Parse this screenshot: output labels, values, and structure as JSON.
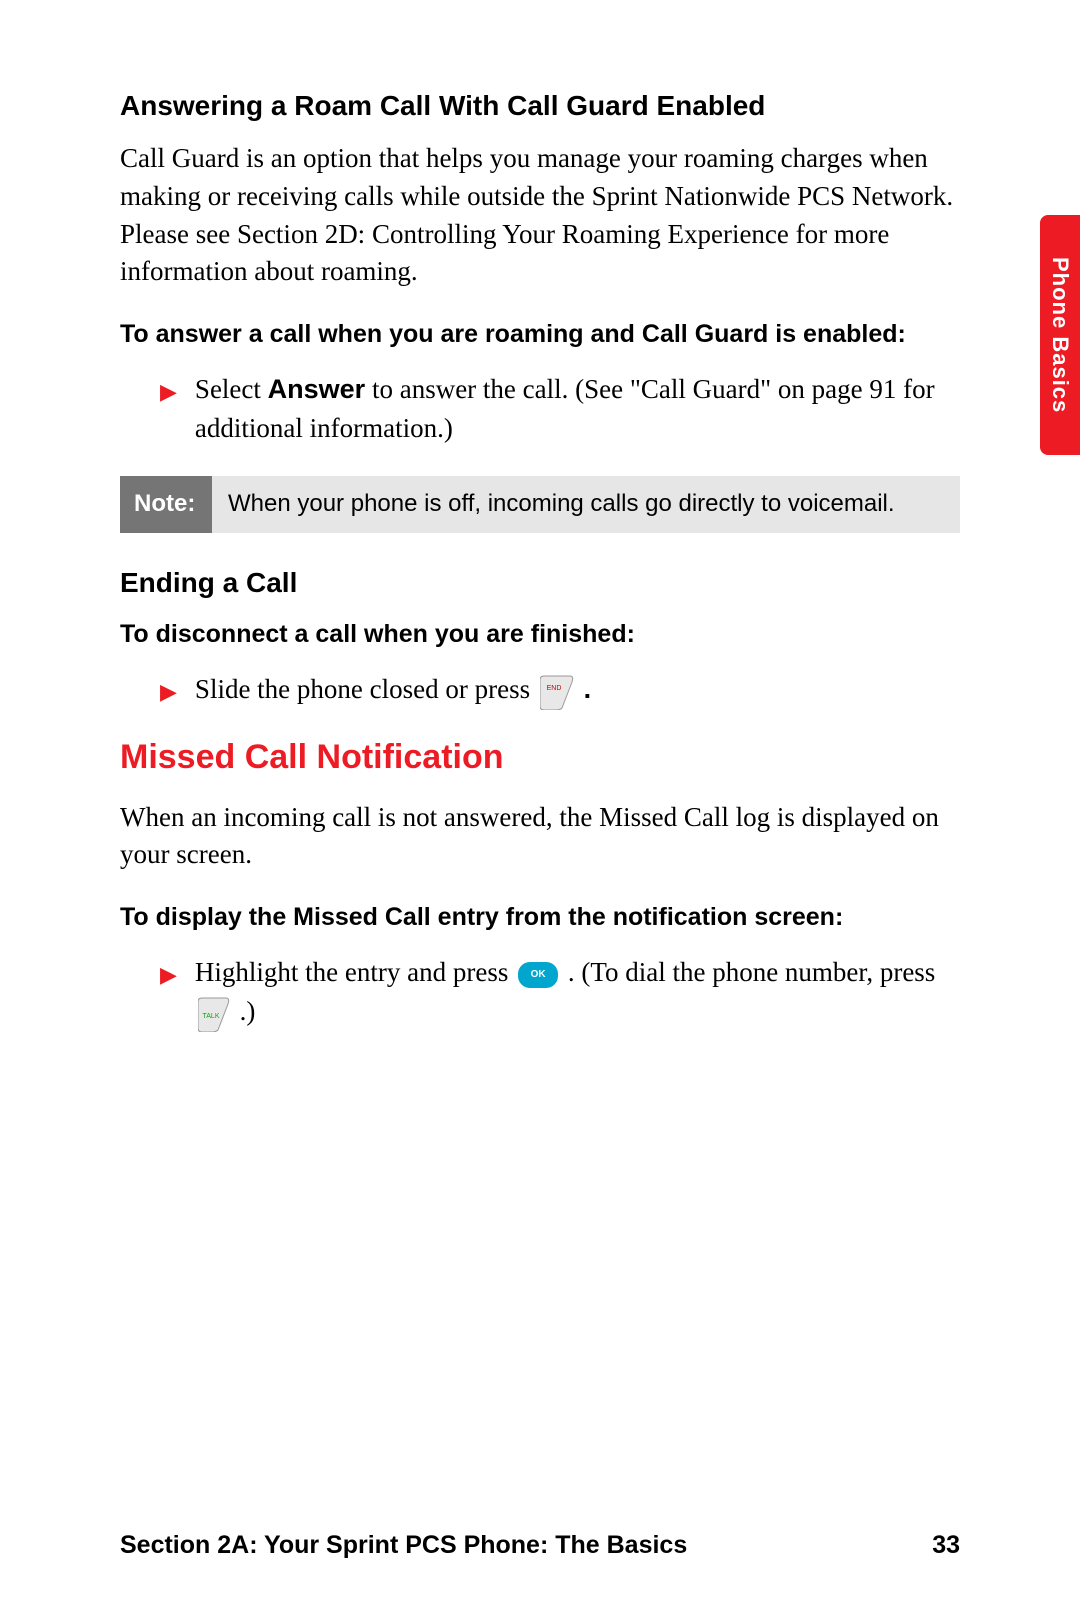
{
  "sidebar": {
    "label": "Phone Basics"
  },
  "section1": {
    "heading": "Answering a Roam Call With Call Guard Enabled",
    "body": "Call Guard is an option that helps you manage your roaming charges when making or receiving calls while outside the Sprint Nationwide PCS Network. Please see Section 2D: Controlling Your Roaming Experience for more information about roaming.",
    "instruction": "To answer a call when you are roaming and Call Guard is enabled:",
    "bullet_prefix": "Select ",
    "bullet_bold": "Answer",
    "bullet_suffix": " to answer the call. (See \"Call Guard\" on page 91 for additional information.)"
  },
  "note": {
    "label": "Note:",
    "text": "When your phone is off, incoming calls go directly to voicemail."
  },
  "section2": {
    "heading": "Ending a Call",
    "instruction": "To disconnect a call when you are finished:",
    "bullet_text_before": "Slide the phone closed or press ",
    "bullet_text_after": "."
  },
  "section3": {
    "heading": "Missed Call Notification",
    "body": "When an incoming call is not answered, the Missed Call log is displayed on your screen.",
    "instruction": "To display the Missed Call entry from the notification screen:",
    "bullet_a": "Highlight the entry and press ",
    "bullet_b": ". (To dial the phone number, press ",
    "bullet_c": ".)"
  },
  "footer": {
    "section_label": "Section 2A: Your Sprint PCS Phone: The Basics",
    "page_number": "33"
  },
  "icons": {
    "end_key": "END",
    "ok_key": "OK",
    "talk_key": "TALK"
  }
}
